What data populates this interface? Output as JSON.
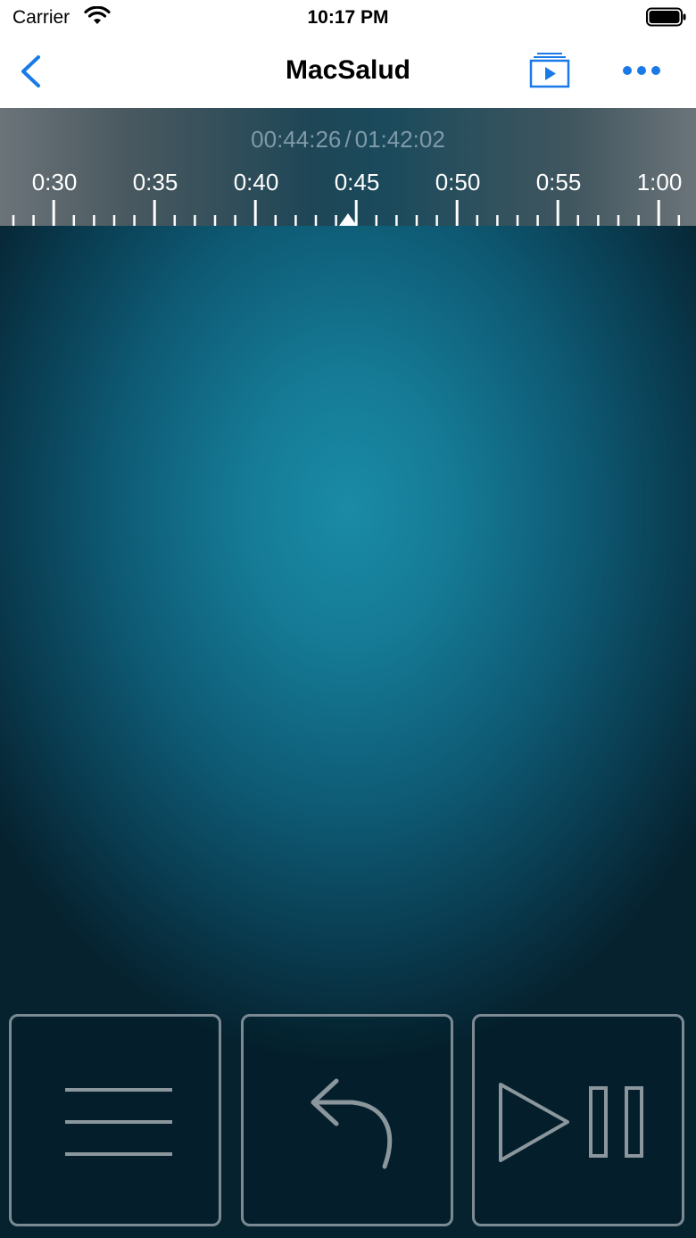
{
  "status_bar": {
    "carrier": "Carrier",
    "time": "10:17 PM"
  },
  "nav": {
    "title": "MacSalud",
    "back_icon": "chevron-left-icon",
    "playlist_icon": "playlist-play-icon",
    "more_icon": "ellipsis-icon",
    "accent_color": "#1a7ae8"
  },
  "timeline": {
    "current_time": "00:44:26",
    "separator": "/",
    "total_time": "01:42:02",
    "labels": [
      "0:30",
      "0:35",
      "0:40",
      "0:45",
      "0:50",
      "0:55",
      "1:00"
    ],
    "playhead_marker": "triangle-up-icon"
  },
  "controls": {
    "menu_icon": "hamburger-menu-icon",
    "return_icon": "undo-arrow-icon",
    "play_pause_icon": "play-pause-icon"
  },
  "colors": {
    "background_center": "#1a8ba6",
    "background_edge": "#06222f",
    "timeline_text": "#7f9aa8",
    "button_border": "#7c8b93"
  }
}
